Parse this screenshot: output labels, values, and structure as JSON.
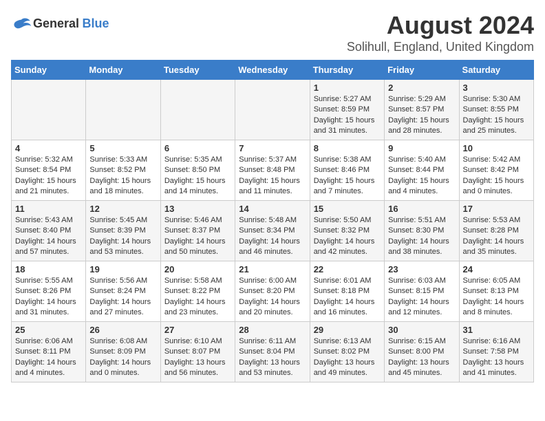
{
  "logo": {
    "general": "General",
    "blue": "Blue"
  },
  "title": "August 2024",
  "subtitle": "Solihull, England, United Kingdom",
  "days_of_week": [
    "Sunday",
    "Monday",
    "Tuesday",
    "Wednesday",
    "Thursday",
    "Friday",
    "Saturday"
  ],
  "weeks": [
    [
      {
        "day": "",
        "sunrise": "",
        "sunset": "",
        "daylight": ""
      },
      {
        "day": "",
        "sunrise": "",
        "sunset": "",
        "daylight": ""
      },
      {
        "day": "",
        "sunrise": "",
        "sunset": "",
        "daylight": ""
      },
      {
        "day": "",
        "sunrise": "",
        "sunset": "",
        "daylight": ""
      },
      {
        "day": "1",
        "sunrise": "Sunrise: 5:27 AM",
        "sunset": "Sunset: 8:59 PM",
        "daylight": "Daylight: 15 hours and 31 minutes."
      },
      {
        "day": "2",
        "sunrise": "Sunrise: 5:29 AM",
        "sunset": "Sunset: 8:57 PM",
        "daylight": "Daylight: 15 hours and 28 minutes."
      },
      {
        "day": "3",
        "sunrise": "Sunrise: 5:30 AM",
        "sunset": "Sunset: 8:55 PM",
        "daylight": "Daylight: 15 hours and 25 minutes."
      }
    ],
    [
      {
        "day": "4",
        "sunrise": "Sunrise: 5:32 AM",
        "sunset": "Sunset: 8:54 PM",
        "daylight": "Daylight: 15 hours and 21 minutes."
      },
      {
        "day": "5",
        "sunrise": "Sunrise: 5:33 AM",
        "sunset": "Sunset: 8:52 PM",
        "daylight": "Daylight: 15 hours and 18 minutes."
      },
      {
        "day": "6",
        "sunrise": "Sunrise: 5:35 AM",
        "sunset": "Sunset: 8:50 PM",
        "daylight": "Daylight: 15 hours and 14 minutes."
      },
      {
        "day": "7",
        "sunrise": "Sunrise: 5:37 AM",
        "sunset": "Sunset: 8:48 PM",
        "daylight": "Daylight: 15 hours and 11 minutes."
      },
      {
        "day": "8",
        "sunrise": "Sunrise: 5:38 AM",
        "sunset": "Sunset: 8:46 PM",
        "daylight": "Daylight: 15 hours and 7 minutes."
      },
      {
        "day": "9",
        "sunrise": "Sunrise: 5:40 AM",
        "sunset": "Sunset: 8:44 PM",
        "daylight": "Daylight: 15 hours and 4 minutes."
      },
      {
        "day": "10",
        "sunrise": "Sunrise: 5:42 AM",
        "sunset": "Sunset: 8:42 PM",
        "daylight": "Daylight: 15 hours and 0 minutes."
      }
    ],
    [
      {
        "day": "11",
        "sunrise": "Sunrise: 5:43 AM",
        "sunset": "Sunset: 8:40 PM",
        "daylight": "Daylight: 14 hours and 57 minutes."
      },
      {
        "day": "12",
        "sunrise": "Sunrise: 5:45 AM",
        "sunset": "Sunset: 8:39 PM",
        "daylight": "Daylight: 14 hours and 53 minutes."
      },
      {
        "day": "13",
        "sunrise": "Sunrise: 5:46 AM",
        "sunset": "Sunset: 8:37 PM",
        "daylight": "Daylight: 14 hours and 50 minutes."
      },
      {
        "day": "14",
        "sunrise": "Sunrise: 5:48 AM",
        "sunset": "Sunset: 8:34 PM",
        "daylight": "Daylight: 14 hours and 46 minutes."
      },
      {
        "day": "15",
        "sunrise": "Sunrise: 5:50 AM",
        "sunset": "Sunset: 8:32 PM",
        "daylight": "Daylight: 14 hours and 42 minutes."
      },
      {
        "day": "16",
        "sunrise": "Sunrise: 5:51 AM",
        "sunset": "Sunset: 8:30 PM",
        "daylight": "Daylight: 14 hours and 38 minutes."
      },
      {
        "day": "17",
        "sunrise": "Sunrise: 5:53 AM",
        "sunset": "Sunset: 8:28 PM",
        "daylight": "Daylight: 14 hours and 35 minutes."
      }
    ],
    [
      {
        "day": "18",
        "sunrise": "Sunrise: 5:55 AM",
        "sunset": "Sunset: 8:26 PM",
        "daylight": "Daylight: 14 hours and 31 minutes."
      },
      {
        "day": "19",
        "sunrise": "Sunrise: 5:56 AM",
        "sunset": "Sunset: 8:24 PM",
        "daylight": "Daylight: 14 hours and 27 minutes."
      },
      {
        "day": "20",
        "sunrise": "Sunrise: 5:58 AM",
        "sunset": "Sunset: 8:22 PM",
        "daylight": "Daylight: 14 hours and 23 minutes."
      },
      {
        "day": "21",
        "sunrise": "Sunrise: 6:00 AM",
        "sunset": "Sunset: 8:20 PM",
        "daylight": "Daylight: 14 hours and 20 minutes."
      },
      {
        "day": "22",
        "sunrise": "Sunrise: 6:01 AM",
        "sunset": "Sunset: 8:18 PM",
        "daylight": "Daylight: 14 hours and 16 minutes."
      },
      {
        "day": "23",
        "sunrise": "Sunrise: 6:03 AM",
        "sunset": "Sunset: 8:15 PM",
        "daylight": "Daylight: 14 hours and 12 minutes."
      },
      {
        "day": "24",
        "sunrise": "Sunrise: 6:05 AM",
        "sunset": "Sunset: 8:13 PM",
        "daylight": "Daylight: 14 hours and 8 minutes."
      }
    ],
    [
      {
        "day": "25",
        "sunrise": "Sunrise: 6:06 AM",
        "sunset": "Sunset: 8:11 PM",
        "daylight": "Daylight: 14 hours and 4 minutes."
      },
      {
        "day": "26",
        "sunrise": "Sunrise: 6:08 AM",
        "sunset": "Sunset: 8:09 PM",
        "daylight": "Daylight: 14 hours and 0 minutes."
      },
      {
        "day": "27",
        "sunrise": "Sunrise: 6:10 AM",
        "sunset": "Sunset: 8:07 PM",
        "daylight": "Daylight: 13 hours and 56 minutes."
      },
      {
        "day": "28",
        "sunrise": "Sunrise: 6:11 AM",
        "sunset": "Sunset: 8:04 PM",
        "daylight": "Daylight: 13 hours and 53 minutes."
      },
      {
        "day": "29",
        "sunrise": "Sunrise: 6:13 AM",
        "sunset": "Sunset: 8:02 PM",
        "daylight": "Daylight: 13 hours and 49 minutes."
      },
      {
        "day": "30",
        "sunrise": "Sunrise: 6:15 AM",
        "sunset": "Sunset: 8:00 PM",
        "daylight": "Daylight: 13 hours and 45 minutes."
      },
      {
        "day": "31",
        "sunrise": "Sunrise: 6:16 AM",
        "sunset": "Sunset: 7:58 PM",
        "daylight": "Daylight: 13 hours and 41 minutes."
      }
    ]
  ]
}
